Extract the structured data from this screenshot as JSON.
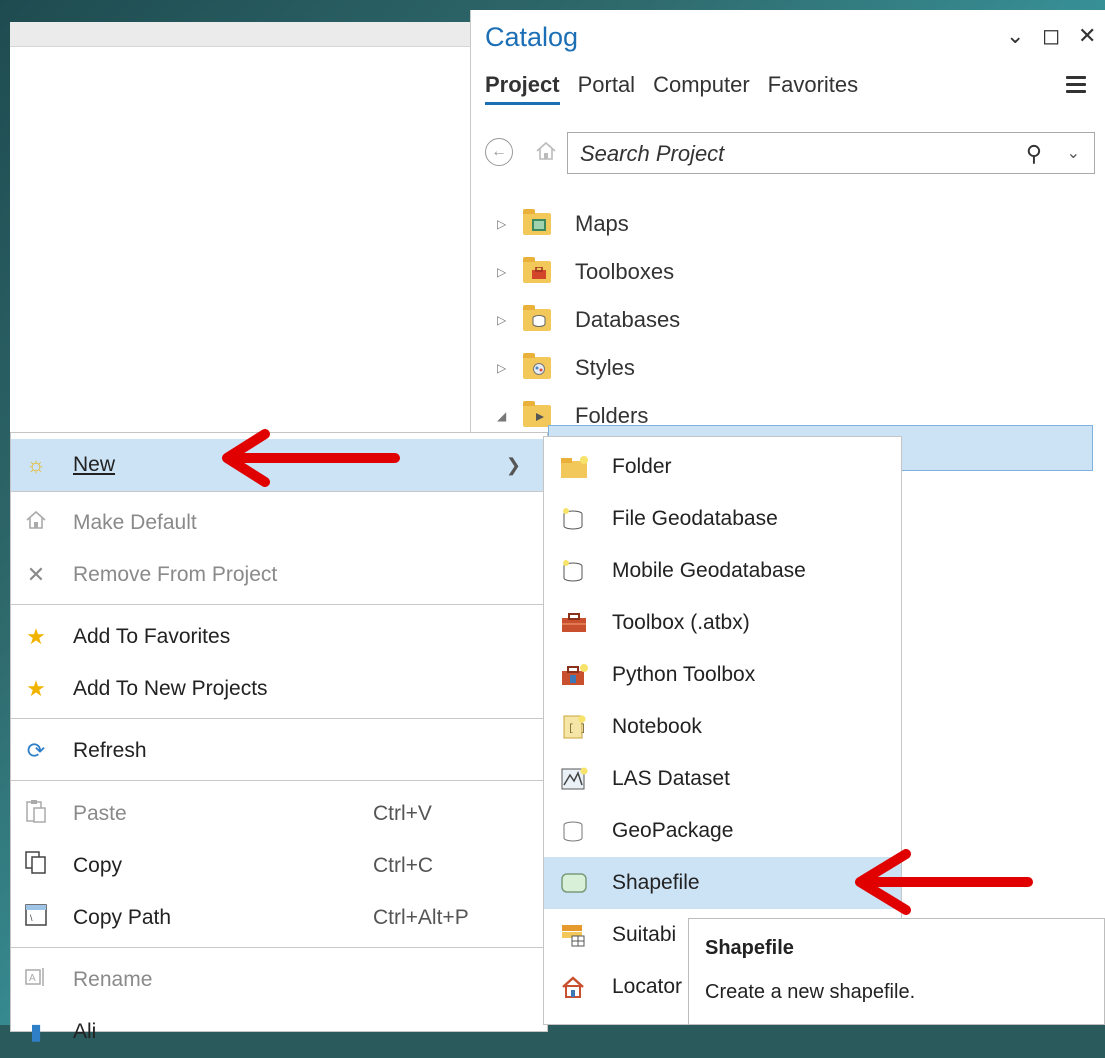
{
  "catalog": {
    "title": "Catalog",
    "window_buttons": [
      "⌄",
      "◻",
      "✕"
    ],
    "tabs": [
      "Project",
      "Portal",
      "Computer",
      "Favorites"
    ],
    "search_placeholder": "Search Project",
    "tree": [
      {
        "label": "Maps",
        "icon": "maps-folder-icon"
      },
      {
        "label": "Toolboxes",
        "icon": "toolboxes-folder-icon"
      },
      {
        "label": "Databases",
        "icon": "databases-folder-icon"
      },
      {
        "label": "Styles",
        "icon": "styles-folder-icon"
      },
      {
        "label": "Folders",
        "icon": "folders-folder-icon",
        "expanded": true
      }
    ]
  },
  "context_menu": {
    "new": "New",
    "make_default": "Make Default",
    "remove_from_project": "Remove From Project",
    "add_to_favorites": "Add To Favorites",
    "add_to_new_projects": "Add To New Projects",
    "refresh": "Refresh",
    "paste": "Paste",
    "paste_shortcut": "Ctrl+V",
    "copy": "Copy",
    "copy_shortcut": "Ctrl+C",
    "copy_path": "Copy Path",
    "copy_path_shortcut": "Ctrl+Alt+P",
    "rename": "Rename",
    "partial_last": "Ali"
  },
  "submenu": {
    "items": [
      "Folder",
      "File Geodatabase",
      "Mobile Geodatabase",
      "Toolbox (.atbx)",
      "Python Toolbox",
      "Notebook",
      "LAS Dataset",
      "GeoPackage",
      "Shapefile",
      "Suitabi",
      "Locator"
    ],
    "highlighted": "Shapefile"
  },
  "tooltip": {
    "title": "Shapefile",
    "description": "Create a new shapefile."
  },
  "colors": {
    "accent": "#1d6fb5",
    "highlight": "#cce3f6",
    "arrow": "#e00000"
  }
}
